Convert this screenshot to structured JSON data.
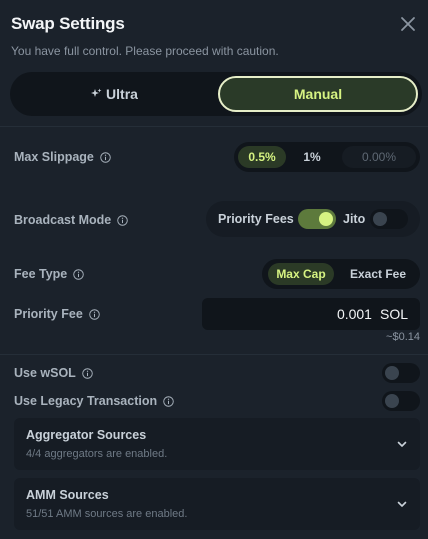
{
  "header": {
    "title": "Swap Settings",
    "subtitle": "You have full control. Please proceed with caution."
  },
  "mode_toggle": {
    "ultra_label": "Ultra",
    "manual_label": "Manual",
    "selected": "Manual"
  },
  "max_slippage": {
    "label": "Max Slippage",
    "options": [
      "0.5%",
      "1%"
    ],
    "selected": "0.5%",
    "custom_placeholder": "0.00%"
  },
  "broadcast_mode": {
    "label": "Broadcast Mode",
    "priority_fees_label": "Priority Fees",
    "priority_fees_on": true,
    "jito_label": "Jito",
    "jito_on": false
  },
  "fee_type": {
    "label": "Fee Type",
    "options": [
      "Max Cap",
      "Exact Fee"
    ],
    "selected": "Max Cap"
  },
  "priority_fee": {
    "label": "Priority Fee",
    "value": "0.001",
    "unit": "SOL",
    "usd_estimate": "~$0.14"
  },
  "use_wsol": {
    "label": "Use wSOL",
    "on": false
  },
  "legacy_tx": {
    "label": "Use Legacy Transaction",
    "on": false
  },
  "aggregator_sources": {
    "title": "Aggregator Sources",
    "description": "4/4 aggregators are enabled."
  },
  "amm_sources": {
    "title": "AMM Sources",
    "description": "51/51 AMM sources are enabled."
  },
  "colors": {
    "background": "#1b222b",
    "accent": "#d6f382",
    "accent_bg": "#2b3a26",
    "toggle_on": "#5d7a3c"
  }
}
